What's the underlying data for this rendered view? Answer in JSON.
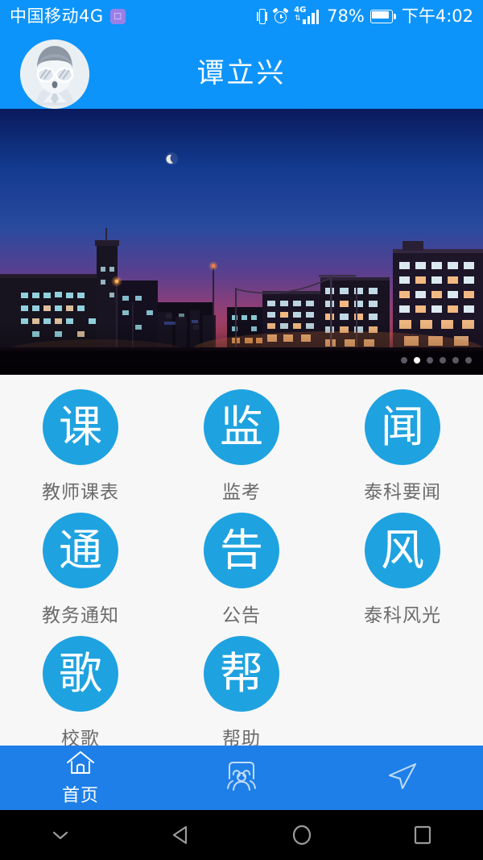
{
  "status_bar": {
    "carrier": "中国移动4G",
    "sim_badge_icon": "sim-card-icon",
    "vibrate_icon": "vibrate-icon",
    "alarm_icon": "alarm-clock-icon",
    "network_type": "4G",
    "signal_icon": "signal-bars-icon",
    "battery_percent": "78%",
    "battery_icon": "battery-icon",
    "time": "下午4:02"
  },
  "app_bar": {
    "title": "谭立兴",
    "avatar_icon": "user-avatar-icon"
  },
  "banner": {
    "alt": "校园夜景",
    "dot_count": 6,
    "active_dot_index": 1
  },
  "grid": {
    "items": [
      {
        "glyph": "课",
        "label": "教师课表",
        "name": "teacher-schedule"
      },
      {
        "glyph": "监",
        "label": "监考",
        "name": "exam-proctoring"
      },
      {
        "glyph": "闻",
        "label": "泰科要闻",
        "name": "taike-news"
      },
      {
        "glyph": "通",
        "label": "教务通知",
        "name": "academic-notice"
      },
      {
        "glyph": "告",
        "label": "公告",
        "name": "announcement"
      },
      {
        "glyph": "风",
        "label": "泰科风光",
        "name": "taike-scenery"
      },
      {
        "glyph": "歌",
        "label": "校歌",
        "name": "school-song"
      },
      {
        "glyph": "帮",
        "label": "帮助",
        "name": "help"
      }
    ]
  },
  "tab_bar": {
    "tabs": [
      {
        "label": "首页",
        "icon": "home-icon",
        "active": true
      },
      {
        "label": "",
        "icon": "contacts-icon",
        "active": false
      },
      {
        "label": "",
        "icon": "send-icon",
        "active": false
      }
    ]
  },
  "android_nav": {
    "hide_keyboard_icon": "chevron-down-icon",
    "back_icon": "triangle-back-icon",
    "home_icon": "circle-home-icon",
    "recents_icon": "square-recents-icon"
  },
  "colors": {
    "header_blue": "#0d94fa",
    "tabbar_blue": "#1f7fe8",
    "circle_blue": "#1fa2e0",
    "label_gray": "#6b6b6b",
    "content_bg": "#f7f7f7"
  }
}
